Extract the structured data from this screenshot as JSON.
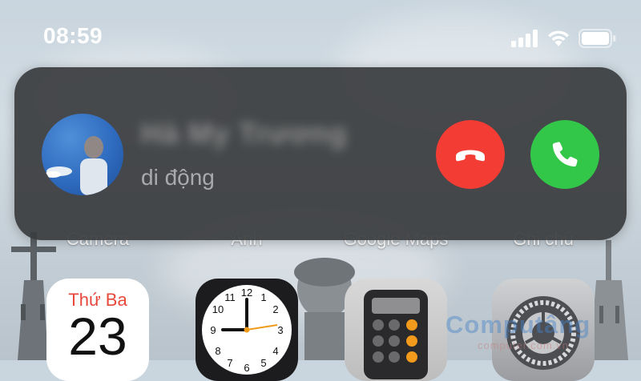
{
  "status_bar": {
    "time": "08:59",
    "icons": [
      "cellular-signal-icon",
      "wifi-icon",
      "battery-icon"
    ]
  },
  "incoming_call": {
    "caller_name": "Hà My Trương",
    "caller_label": "di động",
    "decline_icon": "phone-hangup-icon",
    "accept_icon": "phone-icon",
    "colors": {
      "banner": "#3a3c3e",
      "decline": "#f23c34",
      "accept": "#33c749"
    }
  },
  "home_screen": {
    "labels": [
      "Camera",
      "Ảnh",
      "Google Maps",
      "Ghi chú"
    ],
    "calendar": {
      "day": "Thứ Ba",
      "date": "23"
    }
  },
  "watermark": {
    "brand": "Compu",
    "brand_suffix": "tâng",
    "domain": "computer.com.vn"
  }
}
